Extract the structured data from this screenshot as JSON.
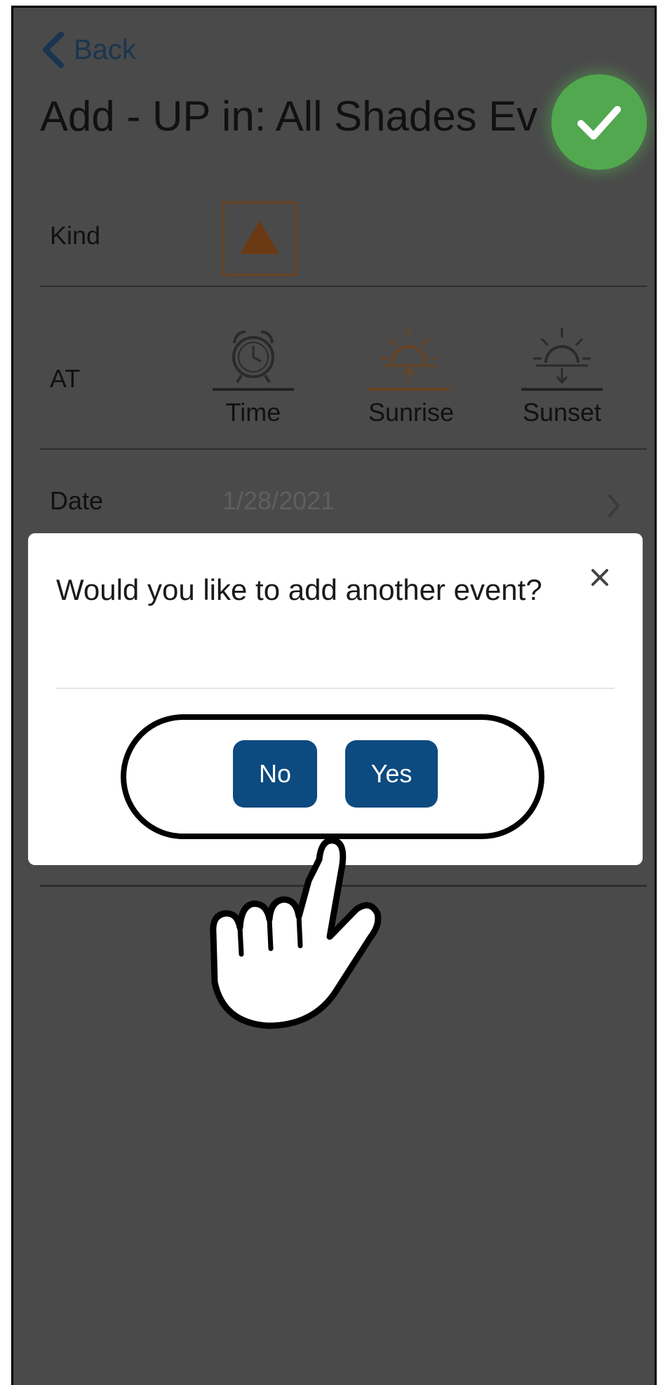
{
  "header": {
    "back_label": "Back",
    "title": "Add -  UP  in:  All Shades Ev"
  },
  "form": {
    "kind_label": "Kind",
    "kind_value": "up-arrow",
    "at_label": "AT",
    "at_options": [
      {
        "label": "Time",
        "icon": "alarm-clock-icon"
      },
      {
        "label": "Sunrise",
        "icon": "sunrise-icon"
      },
      {
        "label": "Sunset",
        "icon": "sunset-icon"
      }
    ],
    "date_label": "Date",
    "date_value": "1/28/2021"
  },
  "dialog": {
    "message": "Would you like to add another event?",
    "close_icon": "close-icon",
    "no_label": "No",
    "yes_label": "Yes"
  },
  "colors": {
    "accent_green": "#52a84f",
    "button_blue": "#0c4a80",
    "sunrise_brown": "#6b4423",
    "backdrop": "#4a4a4a"
  }
}
